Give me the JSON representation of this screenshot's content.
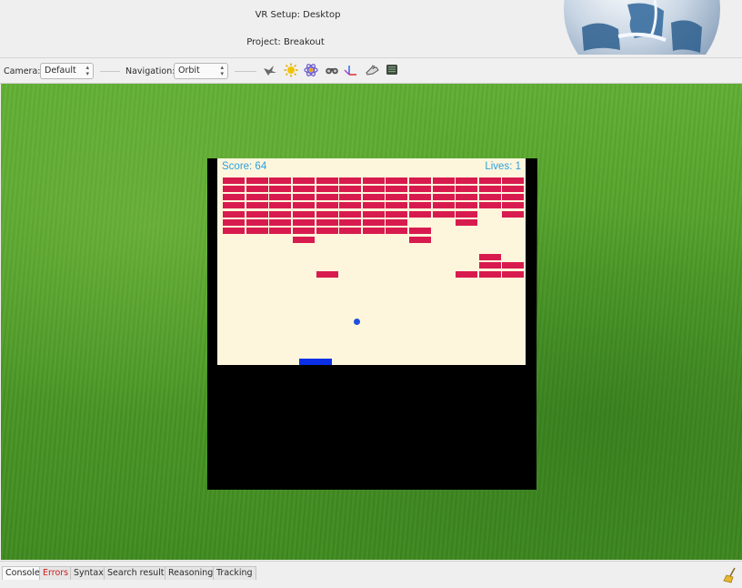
{
  "header": {
    "vr_setup": "VR Setup: Desktop",
    "project": "Project: Breakout"
  },
  "toolbar": {
    "camera_label": "Camera:",
    "camera_value": "Default",
    "navigation_label": "Navigation:",
    "navigation_value": "Orbit",
    "icons": [
      "bird-icon",
      "sun-icon",
      "atom-icon",
      "binoculars-icon",
      "axes-icon",
      "hand-icon",
      "monitor-icon"
    ]
  },
  "game": {
    "score": "Score: 64",
    "lives": "Lives: 1",
    "brick_color": "#d81b4f",
    "ball_color": "#1f4fe0",
    "paddle_color": "#0a2fe6"
  },
  "bottom_tabs": [
    {
      "label": "Console",
      "active": true
    },
    {
      "label": "Errors",
      "error": true
    },
    {
      "label": "Syntax"
    },
    {
      "label": "Search results"
    },
    {
      "label": "Reasoning"
    },
    {
      "label": "Tracking"
    }
  ]
}
